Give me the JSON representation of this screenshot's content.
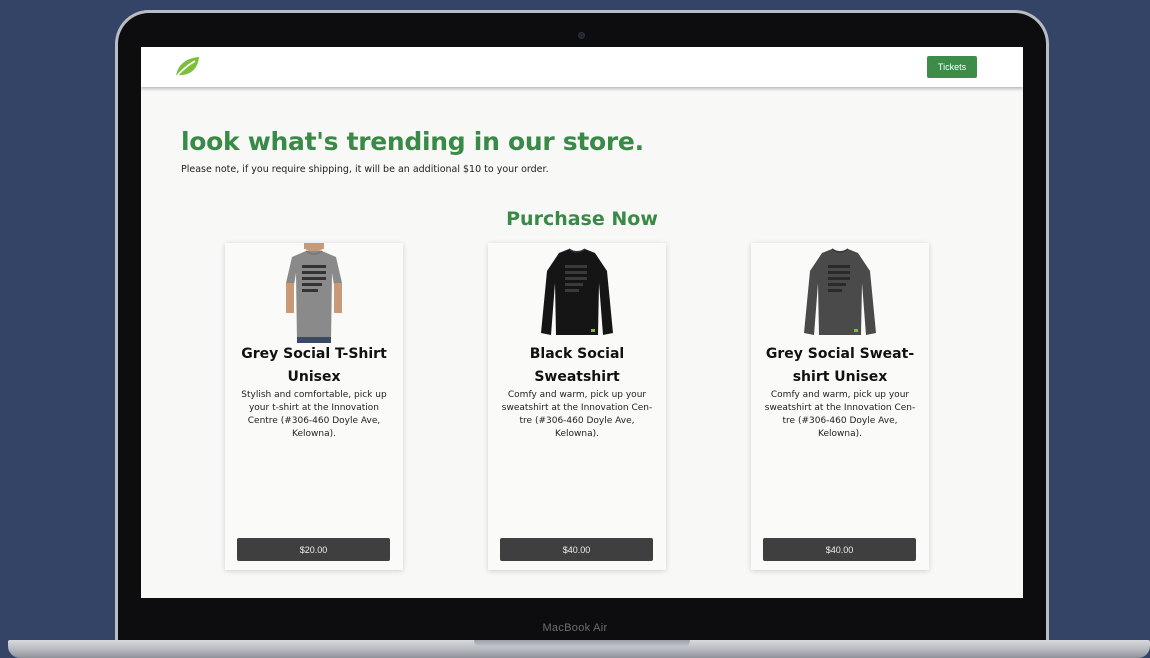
{
  "device": {
    "label": "MacBook Air"
  },
  "nav": {
    "logo_icon": "leaf-icon",
    "tickets_label": "Tickets"
  },
  "hero": {
    "title": "look what's trending in our store.",
    "note": "Please note, if you require shipping, it will be an additional $10 to your order."
  },
  "section": {
    "title": "Purchase Now"
  },
  "products": [
    {
      "image_icon": "grey-tshirt-model-image",
      "title": "Grey Social T-Shirt Unisex",
      "description": "Stylish and comfortable, pick up your t-shirt at the Innovation Centre (#306-460 Doyle Ave, Kelowna).",
      "price": "$20.00"
    },
    {
      "image_icon": "black-sweatshirt-image",
      "title": "Black Social Sweatshirt",
      "description": "Comfy and warm, pick up your sweatshirt at the Innovation Cen-tre (#306-460 Doyle Ave, Kelowna).",
      "price": "$40.00"
    },
    {
      "image_icon": "grey-sweatshirt-image",
      "title": "Grey Social Sweat-shirt Unisex",
      "description": "Comfy and warm, pick up your sweatshirt at the Innovation Cen-tre (#306-460 Doyle Ave, Kelowna).",
      "price": "$40.00"
    }
  ],
  "colors": {
    "background": "#344466",
    "brand_green": "#3a8a47",
    "button_dark": "#3f3f3f"
  }
}
